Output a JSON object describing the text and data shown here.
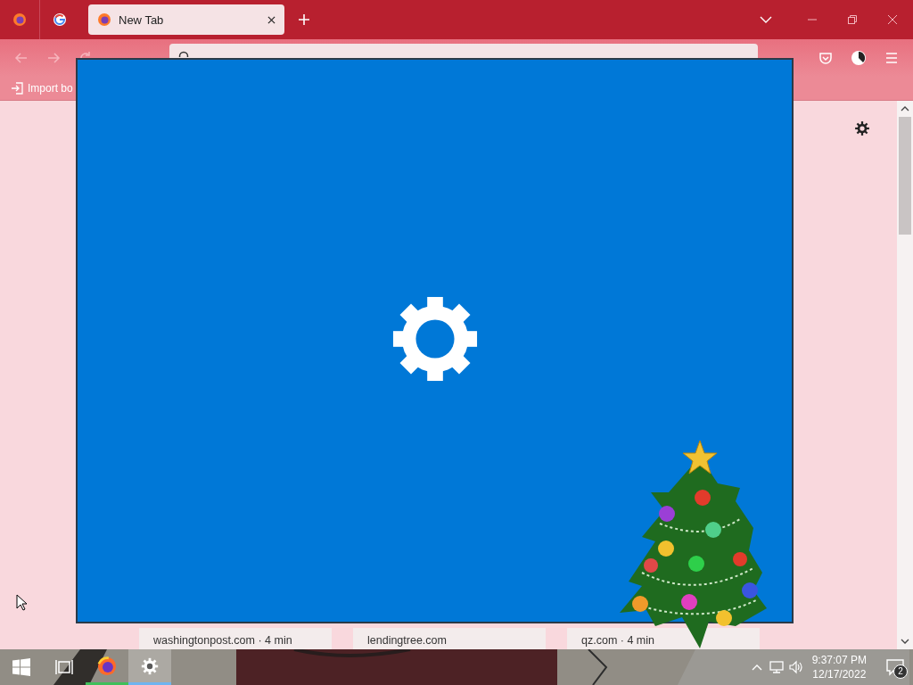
{
  "browser": {
    "tabs": [
      {
        "label": "New Tab",
        "selected": true
      }
    ],
    "bookmarks": [
      {
        "label": "Import bo"
      }
    ],
    "stories": [
      {
        "source": "washingtonpost.com · 4 min"
      },
      {
        "source": "lendingtree.com"
      },
      {
        "source": "qz.com · 4 min"
      }
    ]
  },
  "taskbar": {
    "apps": [
      {
        "kind": "firefox",
        "running": true,
        "focused": false
      },
      {
        "kind": "settings",
        "running": true,
        "focused": true
      }
    ],
    "time": "9:37:07 PM",
    "date": "12/17/2022",
    "notifications": "2"
  }
}
